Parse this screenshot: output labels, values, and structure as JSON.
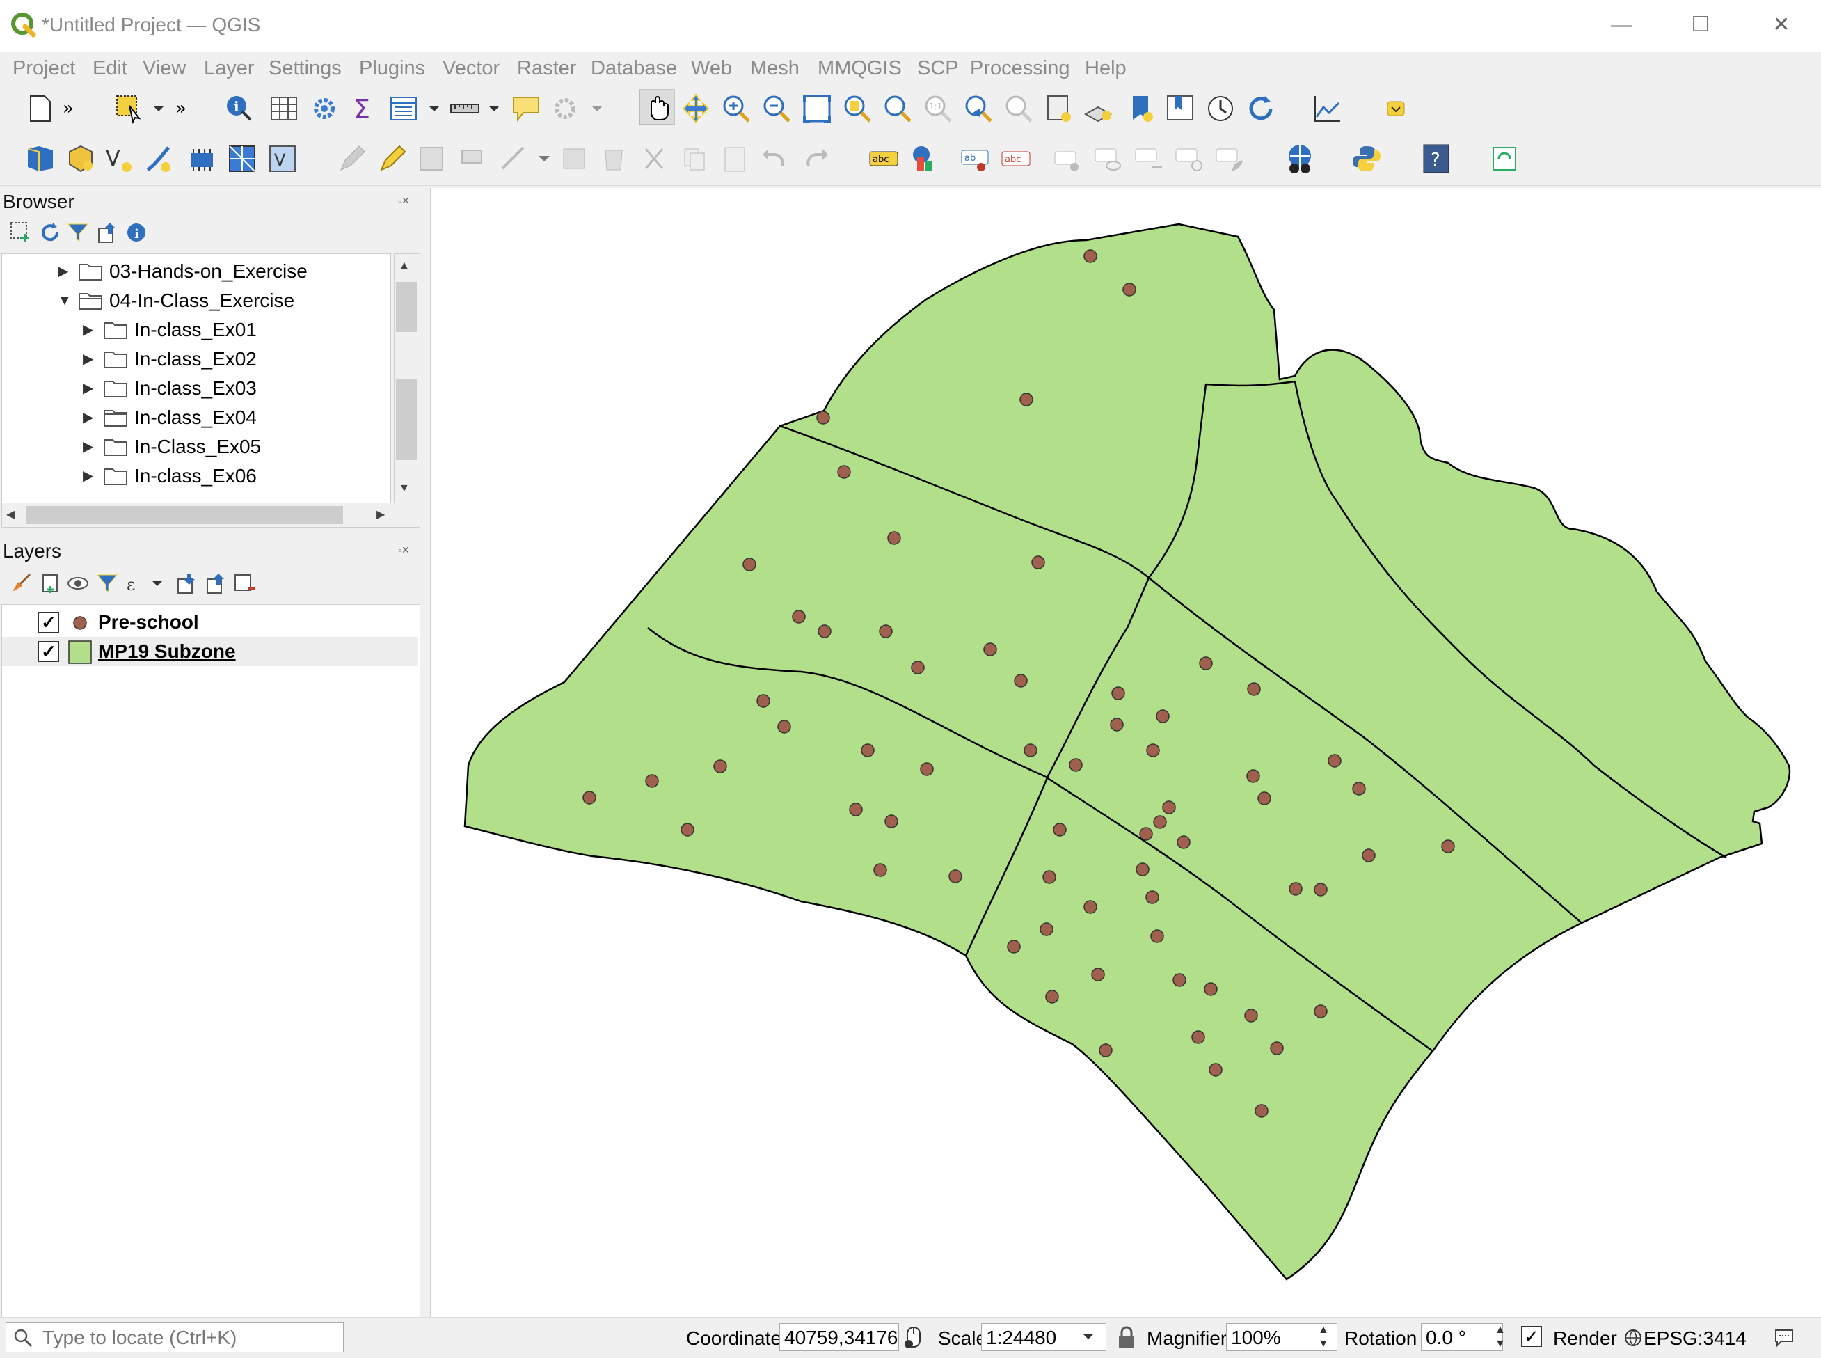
{
  "window": {
    "title": "*Untitled Project — QGIS",
    "minimize": "—",
    "maximize": "☐",
    "close": "✕"
  },
  "menu": [
    "Project",
    "Edit",
    "View",
    "Layer",
    "Settings",
    "Plugins",
    "Vector",
    "Raster",
    "Database",
    "Web",
    "Mesh",
    "MMQGIS",
    "SCP",
    "Processing",
    "Help"
  ],
  "browser": {
    "title": "Browser",
    "items": [
      {
        "label": "03-Hands-on_Exercise",
        "expanded": false
      },
      {
        "label": "04-In-Class_Exercise",
        "expanded": true
      },
      {
        "label": "In-class_Ex01",
        "expanded": false
      },
      {
        "label": "In-class_Ex02",
        "expanded": false
      },
      {
        "label": "In-class_Ex03",
        "expanded": false
      },
      {
        "label": "In-class_Ex04",
        "expanded": false
      },
      {
        "label": "In-Class_Ex05",
        "expanded": false
      },
      {
        "label": "In-class_Ex06",
        "expanded": false
      }
    ]
  },
  "layers": {
    "title": "Layers",
    "items": [
      {
        "label": "Pre-school",
        "checked": true,
        "symbol": "point",
        "color": "#a0604e"
      },
      {
        "label": "MP19 Subzone",
        "checked": true,
        "symbol": "polygon",
        "color": "#b2df8a"
      }
    ]
  },
  "map": {
    "fill_color": "#b2df8a",
    "point_color": "#a0604e"
  },
  "status": {
    "locator_placeholder": "Type to locate (Ctrl+K)",
    "coordinate_label": "Coordinate",
    "coordinate_value": "40759,34176",
    "scale_label": "Scale",
    "scale_value": "1:24480",
    "magnifier_label": "Magnifier",
    "magnifier_value": "100%",
    "rotation_label": "Rotation",
    "rotation_value": "0.0 °",
    "render_label": "Render",
    "crs": "EPSG:3414"
  }
}
